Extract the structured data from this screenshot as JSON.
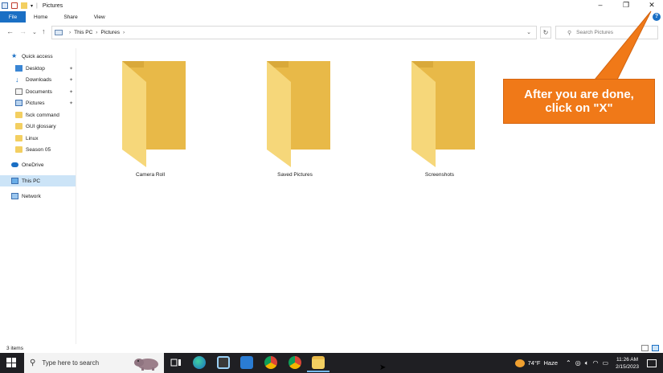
{
  "window": {
    "title": "Pictures",
    "ribbon_tabs": [
      "File",
      "Home",
      "Share",
      "View"
    ],
    "controls": {
      "minimize": "–",
      "restore": "❐",
      "close": "✕"
    }
  },
  "address": {
    "crumbs": [
      "This PC",
      "Pictures"
    ],
    "search_placeholder": "Search Pictures"
  },
  "nav": {
    "items": [
      {
        "label": "Quick access",
        "icon": "star-icon",
        "pinned": false
      },
      {
        "label": "Desktop",
        "icon": "desktop-icon",
        "pinned": true
      },
      {
        "label": "Downloads",
        "icon": "download-icon",
        "pinned": true
      },
      {
        "label": "Documents",
        "icon": "documents-icon",
        "pinned": true
      },
      {
        "label": "Pictures",
        "icon": "pictures-icon",
        "pinned": true
      },
      {
        "label": "fsck command",
        "icon": "folder-icon",
        "pinned": false
      },
      {
        "label": "GUI glossary",
        "icon": "folder-icon",
        "pinned": false
      },
      {
        "label": "Linux",
        "icon": "folder-icon",
        "pinned": false
      },
      {
        "label": "Season 05",
        "icon": "folder-icon",
        "pinned": false
      },
      {
        "label": "OneDrive",
        "icon": "cloud-icon",
        "pinned": false
      },
      {
        "label": "This PC",
        "icon": "pc-icon",
        "pinned": false,
        "selected": true
      },
      {
        "label": "Network",
        "icon": "network-icon",
        "pinned": false
      }
    ]
  },
  "content": {
    "folders": [
      {
        "name": "Camera Roll"
      },
      {
        "name": "Saved Pictures"
      },
      {
        "name": "Screenshots"
      }
    ]
  },
  "callout": {
    "line1": "After you are done,",
    "line2": "click on \"X\"",
    "color": "#f07918"
  },
  "status": {
    "item_count": "3 items"
  },
  "taskbar": {
    "search_placeholder": "Type here to search",
    "weather_temp": "74°F",
    "weather_desc": "Haze",
    "time": "11:26 AM",
    "date": "2/15/2023"
  },
  "colors": {
    "accent": "#1a6fc4",
    "folder": "#f3cf61",
    "taskbar": "#1f1f23"
  }
}
